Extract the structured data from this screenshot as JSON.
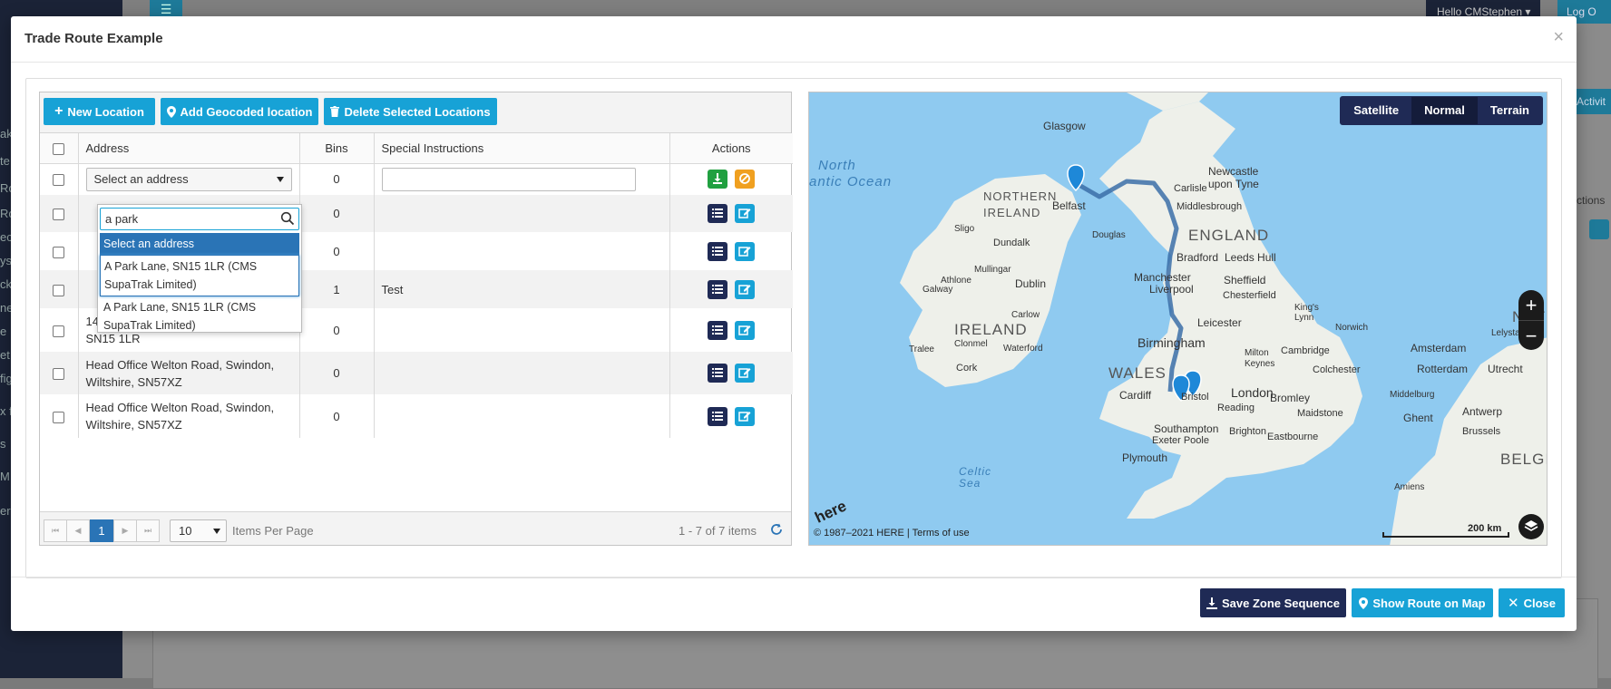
{
  "background": {
    "hello_text": "Hello CMStephen ▾",
    "logout_text": "Log O",
    "activity_text": "Activit",
    "actions_text": "ctions"
  },
  "modal": {
    "title": "Trade Route Example",
    "close_glyph": "×"
  },
  "toolbar": {
    "new_location": "New Location",
    "add_geocoded": "Add Geocoded location",
    "delete_selected": "Delete Selected Locations"
  },
  "grid": {
    "headers": {
      "address": "Address",
      "bins": "Bins",
      "special_instructions": "Special Instructions",
      "actions": "Actions"
    },
    "rows": [
      {
        "address": "Select an address",
        "bins": "0",
        "instructions": ""
      },
      {
        "address": "",
        "bins": "0",
        "instructions": ""
      },
      {
        "address": "",
        "bins": "0",
        "instructions": ""
      },
      {
        "address": "",
        "bins": "1",
        "instructions": "Test"
      },
      {
        "address": "14 Park Lane, Chippenham, Wiltshire, SN15 1LR",
        "bins": "0",
        "instructions": ""
      },
      {
        "address": "Head Office Welton Road, Swindon, Wiltshire, SN57XZ",
        "bins": "0",
        "instructions": ""
      },
      {
        "address": "Head Office Welton Road, Swindon, Wiltshire, SN57XZ",
        "bins": "0",
        "instructions": ""
      }
    ]
  },
  "dropdown": {
    "search_value": "a park",
    "options": [
      "Select an address",
      "A Park Lane, SN15 1LR (CMS SupaTrak Limited)",
      "A Park Lane, SN15 1LR (CMS SupaTrak Limited)"
    ]
  },
  "pager": {
    "first": "⏮",
    "prev": "◀",
    "current_page": "1",
    "next": "▶",
    "last": "⏭",
    "page_size": "10",
    "items_per_page_label": "Items Per Page",
    "summary": "1 - 7 of 7 items"
  },
  "map": {
    "modes": [
      "Satellite",
      "Normal",
      "Terrain"
    ],
    "active_mode": "Normal",
    "zoom_in": "+",
    "zoom_out": "−",
    "copyright": "© 1987–2021 HERE | Terms of use",
    "scale": "200 km",
    "logo": "here",
    "labels": {
      "glasgow": "Glasgow",
      "north_atlantic_1": "North",
      "north_atlantic_2": "antic Ocean",
      "northern_ireland": "NORTHERN IRELAND",
      "belfast": "Belfast",
      "newcastle": "Newcastle upon Tyne",
      "carlisle": "Carlisle",
      "middlesbrough": "Middlesbrough",
      "douglas": "Douglas",
      "england": "ENGLAND",
      "dundalk": "Dundalk",
      "sligo": "Sligo",
      "bradford": "Bradford",
      "leeds_hull": "Leeds Hull",
      "manchester": "Manchester",
      "liverpool": "Liverpool",
      "sheffield": "Sheffield",
      "chesterfield": "Chesterfield",
      "dublin": "Dublin",
      "mullingar": "Mullingar",
      "athlone": "Athlone",
      "galway": "Galway",
      "ireland": "IRELAND",
      "carlow": "Carlow",
      "kings_lynn": "King's Lynn",
      "norwich": "Norwich",
      "leicester": "Leicester",
      "birmingham": "Birmingham",
      "clonmel": "Clonmel",
      "waterford": "Waterford",
      "tralee": "Tralee",
      "cork": "Cork",
      "cambridge": "Cambridge",
      "milton_keynes": "Milton Keynes",
      "amsterdam": "Amsterdam",
      "lelystad": "Lelystad",
      "wales": "WALES",
      "london": "London",
      "colchester": "Colchester",
      "rotterdam": "Rotterdam",
      "utrecht": "Utrecht",
      "cardiff": "Cardiff",
      "bristol": "Bristol",
      "reading": "Reading",
      "bromley": "Bromley",
      "maidstone": "Maidstone",
      "middelburg": "Middelburg",
      "ghent": "Ghent",
      "antwerp": "Antwerp",
      "southampton": "Southampton",
      "exeter_poole": "Exeter Poole",
      "brighton": "Brighton",
      "eastbourne": "Eastbourne",
      "brussels": "Brussels",
      "plymouth": "Plymouth",
      "celtic_sea": "Celtic Sea",
      "belgium": "BELGIU",
      "amiens": "Amiens",
      "netherlands": "NETH"
    }
  },
  "footer": {
    "save_zone": "Save Zone Sequence",
    "show_route": "Show Route on Map",
    "close": "Close"
  },
  "colors": {
    "primary": "#17a2d6",
    "navy": "#1f2a55",
    "success": "#20a040",
    "warning": "#f0a020",
    "water": "#8fcaf0"
  }
}
